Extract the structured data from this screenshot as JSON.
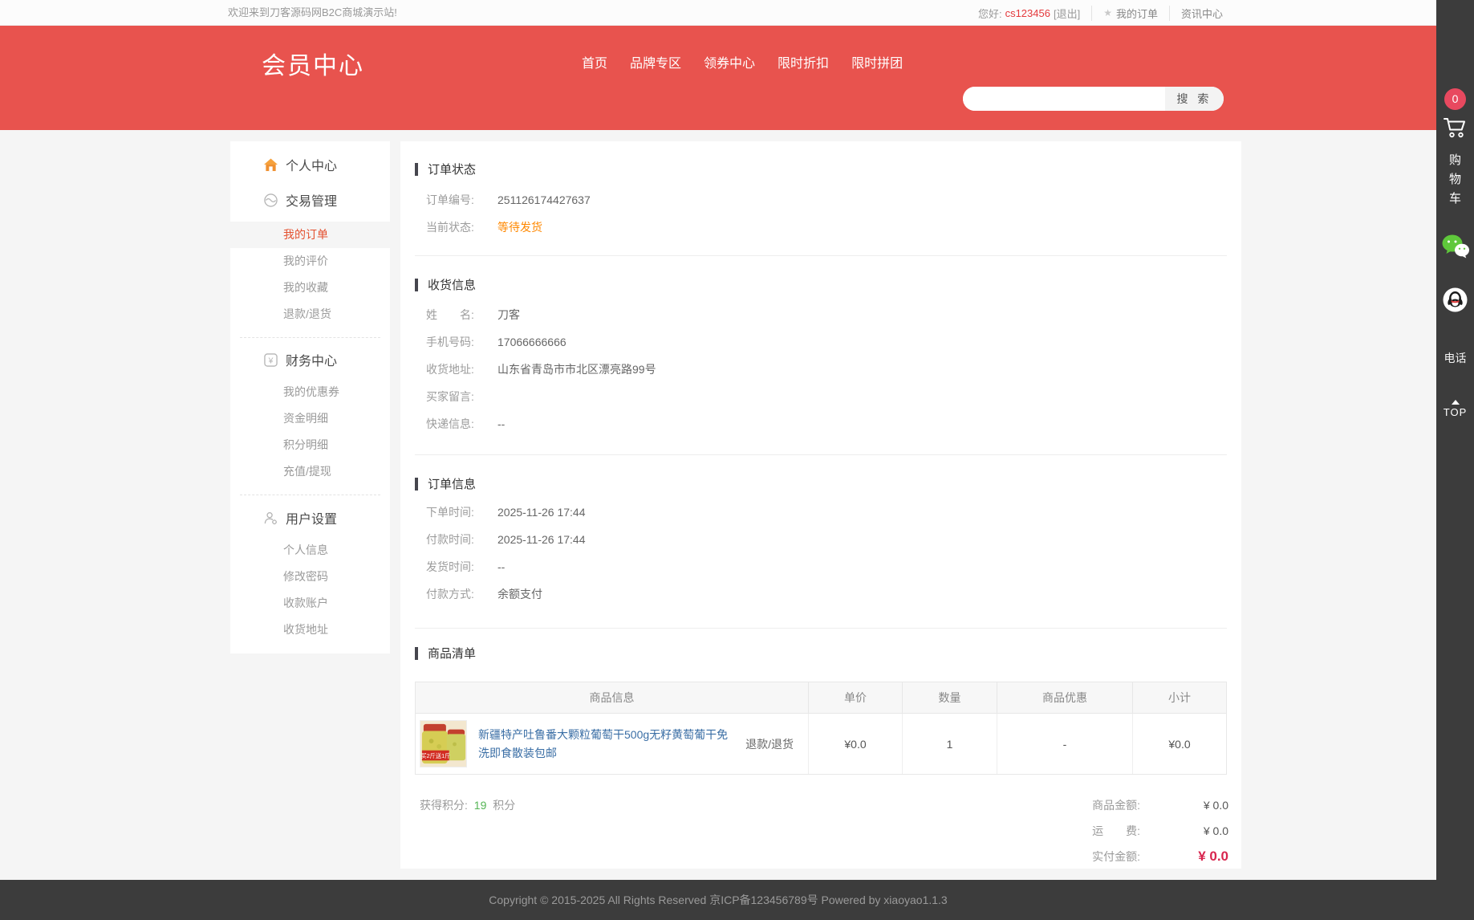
{
  "colors": {
    "brand_red": "#e8534e",
    "status_orange": "#ff8800",
    "active_item_orange": "#e4502f",
    "link_blue": "#3a6ea5",
    "payable_red": "#d8254e",
    "points_green": "#55b555",
    "username_red": "#e4393c",
    "toolbar_dark": "#3c3c3c"
  },
  "topbar": {
    "welcome": "欢迎来到刀客源码网B2C商城演示站!",
    "greeting": "您好:",
    "username": "cs123456",
    "logout": "[退出]",
    "my_orders": "我的订单",
    "news_center": "资讯中心"
  },
  "header": {
    "site_title": "会员中心",
    "nav": [
      "首页",
      "品牌专区",
      "领券中心",
      "限时折扣",
      "限时拼团"
    ],
    "search_button": "搜 索",
    "search_value": ""
  },
  "sidebar": {
    "personal_center": "个人中心",
    "trade": {
      "title": "交易管理",
      "items": [
        "我的订单",
        "我的评价",
        "我的收藏",
        "退款/退货"
      ]
    },
    "finance": {
      "title": "财务中心",
      "items": [
        "我的优惠券",
        "资金明细",
        "积分明细",
        "充值/提现"
      ]
    },
    "settings": {
      "title": "用户设置",
      "items": [
        "个人信息",
        "修改密码",
        "收款账户",
        "收货地址"
      ]
    },
    "active_item": "我的订单"
  },
  "order_status": {
    "title": "订单状态",
    "order_no_label": "订单编号:",
    "order_no": "251126174427637",
    "status_label": "当前状态:",
    "status_value": "等待发货"
  },
  "shipping_info": {
    "title": "收货信息",
    "name_label": "姓　　名:",
    "name": "刀客",
    "phone_label": "手机号码:",
    "phone": "17066666666",
    "address_label": "收货地址:",
    "address": "山东省青岛市市北区漂亮路99号",
    "message_label": "买家留言:",
    "message": "",
    "express_label": "快递信息:",
    "express": "--"
  },
  "order_info": {
    "title": "订单信息",
    "created_label": "下单时间:",
    "created": "2025-11-26 17:44",
    "paid_label": "付款时间:",
    "paid": "2025-11-26 17:44",
    "shipped_label": "发货时间:",
    "shipped": "--",
    "pay_method_label": "付款方式:",
    "pay_method": "余额支付"
  },
  "product_list": {
    "title": "商品清单",
    "headers": [
      "商品信息",
      "单价",
      "数量",
      "商品优惠",
      "小计"
    ],
    "row": {
      "title": "新疆特产吐鲁番大颗粒葡萄干500g无籽黄萄葡干免洗即食散装包邮",
      "refund": "退款/退货",
      "unit_price": "¥0.0",
      "quantity": "1",
      "discount": "-",
      "subtotal": "¥0.0",
      "image_badge": "买2斤送1斤"
    },
    "points_label": "获得积分:",
    "points_value": "19",
    "points_unit": "积分",
    "summary": {
      "goods_label": "商品金额:",
      "goods_value": "¥ 0.0",
      "freight_label": "运　　费:",
      "freight_value": "¥ 0.0",
      "payable_label": "实付金额:",
      "payable_value": "¥ 0.0"
    }
  },
  "side_toolbar": {
    "cart_count": "0",
    "cart_label": "购物车",
    "phone_label": "电话",
    "back_to_top": "TOP"
  },
  "footer": {
    "copyright": "Copyright © 2015-2025 All Rights Reserved 京ICP备123456789号 Powered by xiaoyao1.1.3"
  }
}
